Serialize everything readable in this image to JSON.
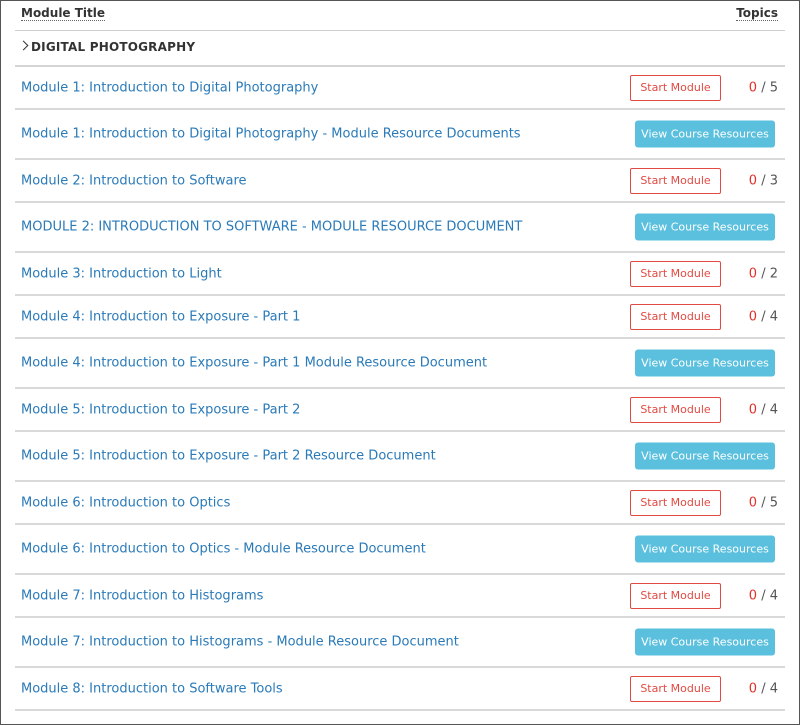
{
  "header": {
    "module_title": "Module Title",
    "topics": "Topics"
  },
  "section": {
    "label": "DIGITAL PHOTOGRAPHY",
    "expand_icon": "chevron-right-icon"
  },
  "buttons": {
    "start": "Start Module",
    "resources": "View Course Resources"
  },
  "colors": {
    "link": "#2a7ab8",
    "start_border": "#e04a43",
    "resources_bg": "#5bc0de",
    "completed_count": "#e0302a"
  },
  "modules": [
    {
      "title": "Module 1: Introduction to Digital Photography",
      "kind": "start",
      "completed": "0",
      "separator": " / ",
      "total": "5"
    },
    {
      "title": "Module 1: Introduction to Digital Photography - Module Resource Documents",
      "kind": "resource"
    },
    {
      "title": "Module 2: Introduction to Software",
      "kind": "start",
      "completed": "0",
      "separator": " / ",
      "total": "3"
    },
    {
      "title": "MODULE 2: INTRODUCTION TO SOFTWARE - MODULE RESOURCE DOCUMENT",
      "kind": "resource"
    },
    {
      "title": "Module 3: Introduction to Light",
      "kind": "start",
      "completed": "0",
      "separator": " / ",
      "total": "2"
    },
    {
      "title": "Module 4: Introduction to Exposure - Part 1",
      "kind": "start",
      "completed": "0",
      "separator": " / ",
      "total": "4"
    },
    {
      "title": "Module 4: Introduction to Exposure - Part 1 Module Resource Document",
      "kind": "resource"
    },
    {
      "title": "Module 5: Introduction to Exposure - Part 2",
      "kind": "start",
      "completed": "0",
      "separator": " / ",
      "total": "4"
    },
    {
      "title": "Module 5: Introduction to Exposure - Part 2 Resource Document",
      "kind": "resource"
    },
    {
      "title": "Module 6: Introduction to Optics",
      "kind": "start",
      "completed": "0",
      "separator": " / ",
      "total": "5"
    },
    {
      "title": "Module 6: Introduction to Optics - Module Resource Document",
      "kind": "resource"
    },
    {
      "title": "Module 7: Introduction to Histograms",
      "kind": "start",
      "completed": "0",
      "separator": " / ",
      "total": "4"
    },
    {
      "title": "Module 7: Introduction to Histograms - Module Resource Document",
      "kind": "resource"
    },
    {
      "title": "Module 8: Introduction to Software Tools",
      "kind": "start",
      "completed": "0",
      "separator": " / ",
      "total": "4"
    }
  ]
}
